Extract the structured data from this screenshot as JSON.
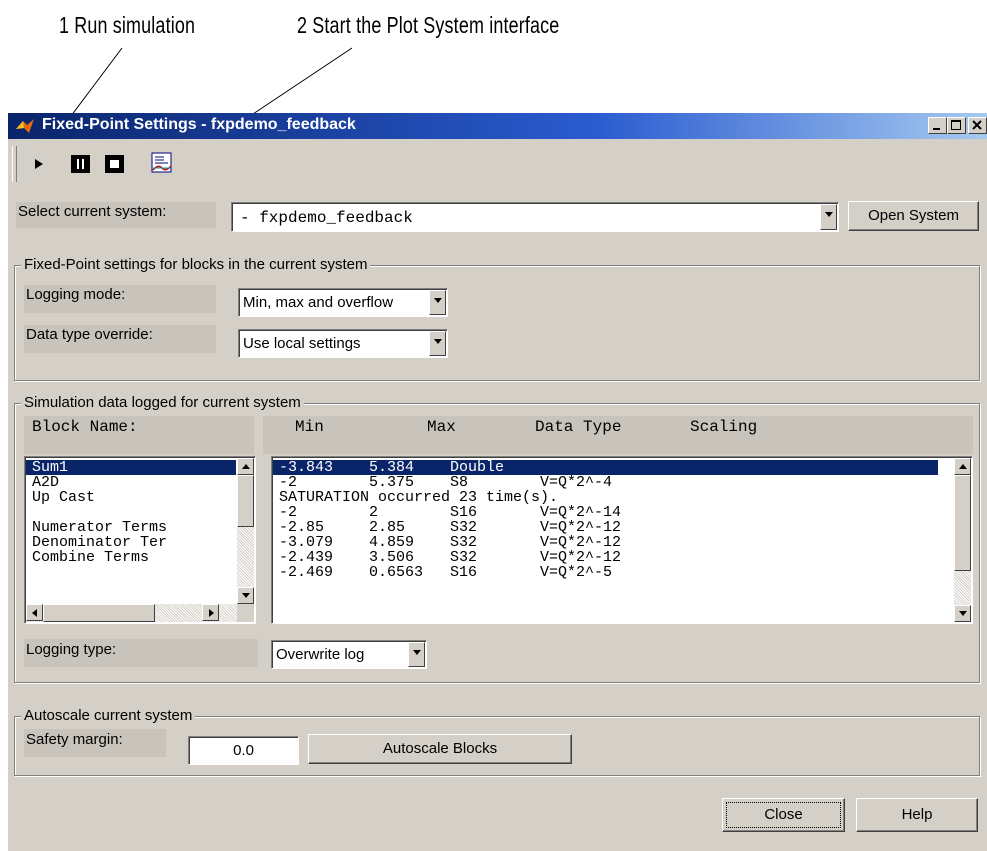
{
  "annotations": {
    "run": "1 Run simulation",
    "plot": "2 Start the Plot System interface"
  },
  "window": {
    "title": "Fixed-Point Settings - fxpdemo_feedback"
  },
  "toolbar": {
    "icons": [
      "play-icon",
      "pause-icon",
      "stop-icon",
      "plot-system-icon"
    ]
  },
  "system": {
    "label": "Select current system:",
    "value": "- fxpdemo_feedback",
    "open_button": "Open System"
  },
  "block_settings": {
    "title": "Fixed-Point settings for blocks in the current system",
    "logging_mode_label": "Logging mode:",
    "logging_mode_value": "Min, max and overflow",
    "override_label": "Data type override:",
    "override_value": "Use local settings"
  },
  "sim_data": {
    "title": "Simulation data logged for current system",
    "block_name_header": "Block Name:",
    "columns": [
      "Min",
      "Max",
      "Data Type",
      "Scaling"
    ],
    "blocks": [
      "Sum1",
      "A2D",
      "Up Cast",
      "",
      "Numerator Terms",
      "Denominator Ter",
      "Combine Terms"
    ],
    "rows": [
      "-3.843    5.384    Double",
      "-2        5.375    S8        V=Q*2^-4",
      "SATURATION occurred 23 time(s).",
      "-2        2        S16       V=Q*2^-14",
      "-2.85     2.85     S32       V=Q*2^-12",
      "-3.079    4.859    S32       V=Q*2^-12",
      "-2.439    3.506    S32       V=Q*2^-12",
      "-2.469    0.6563   S16       V=Q*2^-5"
    ],
    "logging_type_label": "Logging type:",
    "logging_type_value": "Overwrite log"
  },
  "autoscale": {
    "title": "Autoscale current system",
    "safety_label": "Safety margin:",
    "safety_value": "0.0",
    "button": "Autoscale Blocks"
  },
  "footer": {
    "close": "Close",
    "help": "Help"
  }
}
